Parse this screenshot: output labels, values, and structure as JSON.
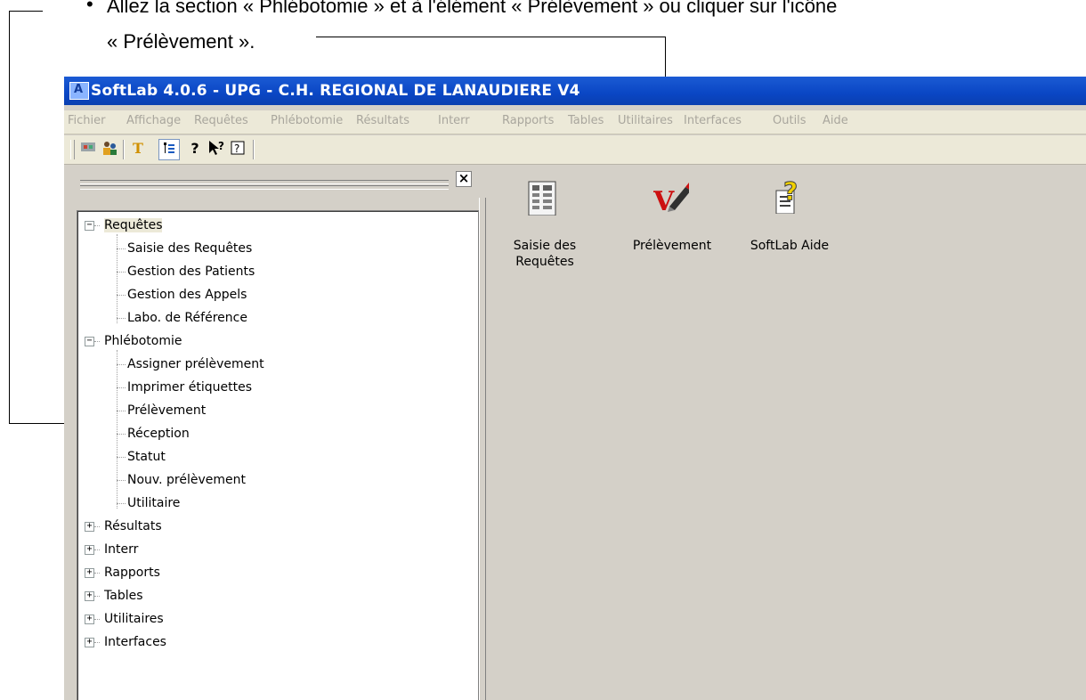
{
  "instruction": {
    "bullet": "•",
    "line1": "Allez  la section « Phlébotomie » et à l'élément « Prélèvement » ou cliquer sur l'icône",
    "line2": "« Prélèvement »."
  },
  "window": {
    "title": "SoftLab 4.0.6 - UPG - C.H. REGIONAL DE LANAUDIERE V4"
  },
  "menu": [
    "Fichier",
    "Affichage",
    "Requêtes",
    "Phlébotomie",
    "Résultats",
    "Interr",
    "Rapports",
    "Tables",
    "Utilitaires",
    "Interfaces",
    "Outils",
    "Aide"
  ],
  "toolbar": {
    "buttons": [
      "tools-icon",
      "users-icon",
      "text-icon",
      "tree-toggle-icon",
      "help-icon",
      "context-help-icon",
      "about-icon"
    ]
  },
  "nav": {
    "close": "×",
    "groups": [
      {
        "label": "Requêtes",
        "expanded": true,
        "children": [
          "Saisie des Requêtes",
          "Gestion des Patients",
          "Gestion des Appels",
          "Labo. de Référence"
        ]
      },
      {
        "label": "Phlébotomie",
        "expanded": true,
        "children": [
          "Assigner prélèvement",
          "Imprimer étiquettes",
          "Prélèvement",
          "Réception",
          "Statut",
          "Nouv. prélèvement",
          "Utilitaire"
        ]
      },
      {
        "label": "Résultats",
        "expanded": false,
        "children": []
      },
      {
        "label": "Interr",
        "expanded": false,
        "children": []
      },
      {
        "label": "Rapports",
        "expanded": false,
        "children": []
      },
      {
        "label": "Tables",
        "expanded": false,
        "children": []
      },
      {
        "label": "Utilitaires",
        "expanded": false,
        "children": []
      },
      {
        "label": "Interfaces",
        "expanded": false,
        "children": []
      }
    ]
  },
  "shortcuts": [
    {
      "label_line1": "Saisie des",
      "label_line2": "Requêtes",
      "icon": "document-form-icon"
    },
    {
      "label_line1": "Prélèvement",
      "label_line2": "",
      "icon": "pen-check-icon"
    },
    {
      "label_line1": "SoftLab Aide",
      "label_line2": "",
      "icon": "help-document-icon"
    }
  ],
  "colors": {
    "titlebar": "#0a46c4",
    "workspace": "#d4d0c8",
    "menubar": "#ece9d8",
    "menu_text": "#a9a69d"
  }
}
